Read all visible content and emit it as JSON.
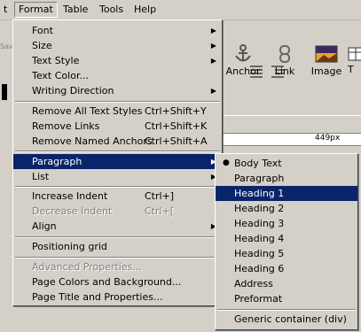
{
  "menubar": {
    "items": [
      {
        "label": "t"
      },
      {
        "label": "Format"
      },
      {
        "label": "Table"
      },
      {
        "label": "Tools"
      },
      {
        "label": "Help"
      }
    ]
  },
  "toolbar": {
    "buttons": [
      {
        "label": "Anchor",
        "icon": "anchor-icon"
      },
      {
        "label": "Link",
        "icon": "link-icon"
      },
      {
        "label": "Image",
        "icon": "image-icon"
      },
      {
        "label": "T",
        "icon": "table-icon"
      }
    ],
    "partial_label": "Sav",
    "width_readout": "449px"
  },
  "format_menu": {
    "items": [
      {
        "label": "Font",
        "submenu": true
      },
      {
        "label": "Size",
        "submenu": true
      },
      {
        "label": "Text Style",
        "submenu": true
      },
      {
        "label": "Text Color..."
      },
      {
        "label": "Writing Direction",
        "submenu": true
      },
      {
        "label": "Remove All Text Styles",
        "shortcut": "Ctrl+Shift+Y"
      },
      {
        "label": "Remove Links",
        "shortcut": "Ctrl+Shift+K"
      },
      {
        "label": "Remove Named Anchors",
        "shortcut": "Ctrl+Shift+A"
      },
      {
        "label": "Paragraph",
        "submenu": true,
        "highlighted": true
      },
      {
        "label": "List",
        "submenu": true
      },
      {
        "label": "Increase Indent",
        "shortcut": "Ctrl+]"
      },
      {
        "label": "Decrease Indent",
        "shortcut": "Ctrl+[",
        "disabled": true
      },
      {
        "label": "Align",
        "submenu": true
      },
      {
        "label": "Positioning grid"
      },
      {
        "label": "Advanced Properties...",
        "disabled": true
      },
      {
        "label": "Page Colors and Background..."
      },
      {
        "label": "Page Title and Properties..."
      }
    ]
  },
  "paragraph_submenu": {
    "items": [
      {
        "label": "Body Text",
        "checked": true
      },
      {
        "label": "Paragraph"
      },
      {
        "label": "Heading 1",
        "highlighted": true
      },
      {
        "label": "Heading 2"
      },
      {
        "label": "Heading 3"
      },
      {
        "label": "Heading 4"
      },
      {
        "label": "Heading 5"
      },
      {
        "label": "Heading 6"
      },
      {
        "label": "Address"
      },
      {
        "label": "Preformat"
      },
      {
        "label": "Generic container (div)"
      }
    ]
  },
  "colors": {
    "highlight": "#0a246a",
    "chrome": "#d4d0c8"
  }
}
